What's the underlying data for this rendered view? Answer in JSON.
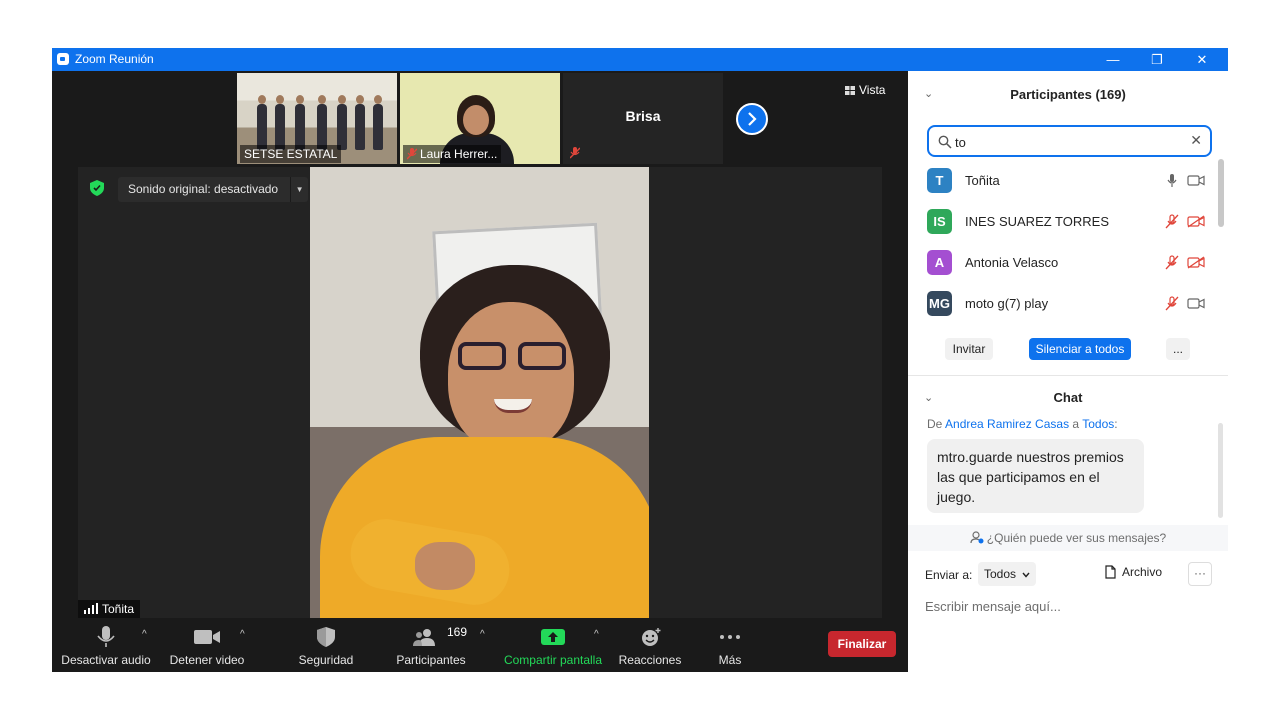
{
  "window": {
    "title": "Zoom Reunión",
    "minimize": "—",
    "restore": "❐",
    "close": "✕"
  },
  "thumbnails": [
    {
      "label": "SETSE ESTATAL"
    },
    {
      "label": "Laura Herrer..."
    },
    {
      "label": "Brisa"
    }
  ],
  "view_button": {
    "label": "Vista"
  },
  "main_video": {
    "audio_setting": "Sonido original: desactivado",
    "speaker_name": "Toñita"
  },
  "toolbar": {
    "mute_audio": "Desactivar audio",
    "stop_video": "Detener video",
    "security": "Seguridad",
    "participants": "Participantes",
    "participants_count": "169",
    "share_screen": "Compartir pantalla",
    "reactions": "Reacciones",
    "more": "Más",
    "end": "Finalizar"
  },
  "participants_panel": {
    "title": "Participantes (169)",
    "search_value": "to",
    "participants": [
      {
        "initials": "T",
        "name": "Toñita",
        "color": "#2d82c3"
      },
      {
        "initials": "IS",
        "name": "INES SUAREZ TORRES",
        "color": "#2fa85a"
      },
      {
        "initials": "A",
        "name": "Antonia Velasco",
        "color": "#a44fd1"
      },
      {
        "initials": "MG",
        "name": "moto g(7) play",
        "color": "#35495e"
      }
    ],
    "invite": "Invitar",
    "mute_all": "Silenciar a todos",
    "more": "..."
  },
  "chat_panel": {
    "title": "Chat",
    "from_prefix": "De",
    "sender": "Andrea Ramirez Casas",
    "to_word": "a",
    "recipient": "Todos",
    "message": "mtro.guarde nuestros premios las que participamos en el juego.",
    "who_sees": "¿Quién puede ver sus mensajes?",
    "send_to_label": "Enviar a:",
    "send_to_value": "Todos",
    "file_label": "Archivo",
    "more": "···",
    "input_placeholder": "Escribir mensaje aquí..."
  },
  "colors": {
    "zoom_blue": "#0e72ed",
    "end_red": "#c7272e",
    "share_green": "#23d959",
    "muted_red": "#e0463b"
  }
}
